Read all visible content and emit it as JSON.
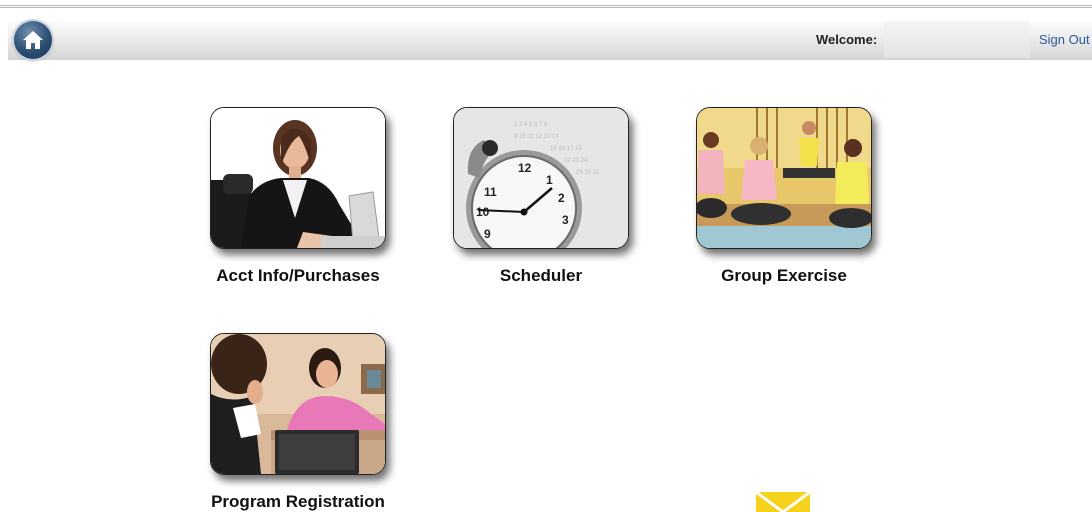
{
  "header": {
    "welcome_label": "Welcome:",
    "welcome_value": "",
    "signout_label": "Sign Out"
  },
  "tiles": [
    {
      "label": "Acct Info/Purchases",
      "image": "businesswoman-at-laptop-photo"
    },
    {
      "label": "Scheduler",
      "image": "stopwatch-on-calendar-photo"
    },
    {
      "label": "Group Exercise",
      "image": "yoga-class-photo"
    },
    {
      "label": "Program Registration",
      "image": "front-desk-registration-photo"
    }
  ],
  "icons": {
    "home": "home-icon",
    "mail": "envelope-icon"
  },
  "colors": {
    "header_gradient_top": "#fcfcfc",
    "header_gradient_bottom": "#d4d4d4",
    "home_button": "#2d4f74",
    "link": "#2a5a9a",
    "envelope": "#f6d21c"
  }
}
